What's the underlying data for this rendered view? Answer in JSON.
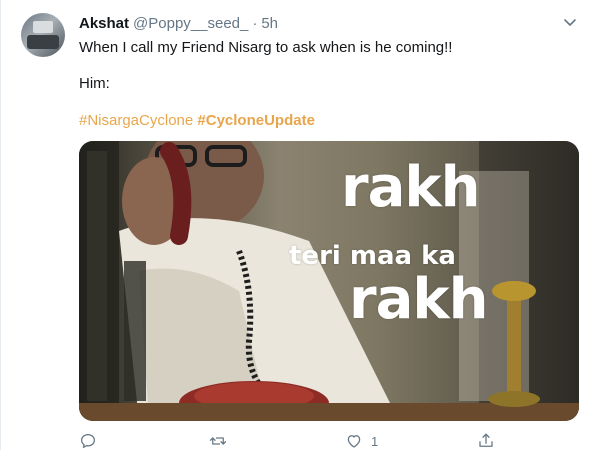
{
  "tweet": {
    "name": "Akshat",
    "handle": "@Poppy__seed_",
    "separator": "·",
    "time": "5h",
    "line1": "When I call my Friend Nisarg to ask when is he coming!!",
    "line2": "Him:",
    "hashtag1": "#NisargaCyclone",
    "hashtag2": "#CycloneUpdate",
    "hashtag_color": "#e8a64c"
  },
  "media": {
    "overlay_line1": "rakh",
    "overlay_line2": "teri maa ka",
    "overlay_line3": "rakh"
  },
  "actions": {
    "reply_icon": "reply-icon",
    "retweet_icon": "retweet-icon",
    "like_icon": "heart-icon",
    "like_count": "1",
    "share_icon": "share-icon"
  }
}
